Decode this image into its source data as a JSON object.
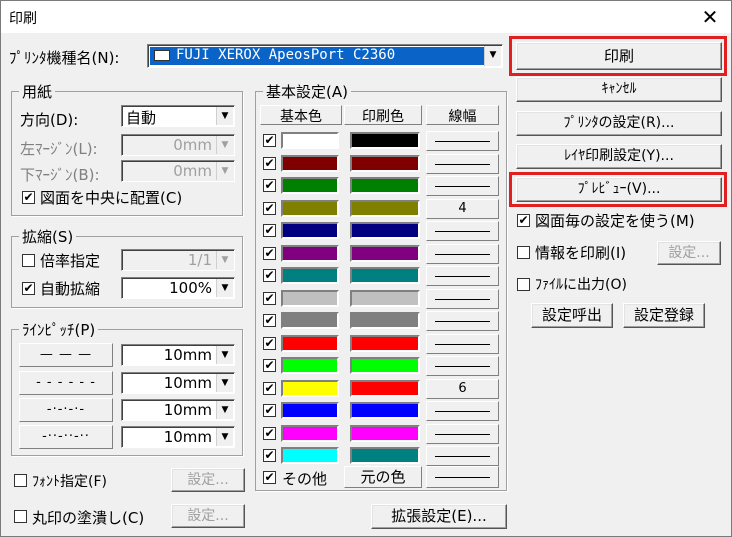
{
  "window": {
    "title": "印刷",
    "close": "✕"
  },
  "printer": {
    "label": "ﾌﾟﾘﾝﾀ機種名(N):",
    "selected": "FUJI XEROX ApeosPort C2360"
  },
  "paper": {
    "group_label": "用紙",
    "direction_label": "方向(D):",
    "direction_value": "自動",
    "left_margin_label": "左ﾏｰｼﾞﾝ(L):",
    "left_margin_value": "0mm",
    "bottom_margin_label": "下ﾏｰｼﾞﾝ(B):",
    "bottom_margin_value": "0mm",
    "center_label": "図面を中央に配置(C)",
    "center_checked": true
  },
  "scale": {
    "group_label": "拡縮(S)",
    "ratio_label": "倍率指定",
    "ratio_checked": false,
    "ratio_value": "1/1",
    "auto_label": "自動拡縮",
    "auto_checked": true,
    "auto_value": "100%"
  },
  "linepitch": {
    "group_label": "ﾗｲﾝﾋﾟｯﾁ(P)",
    "rows": [
      {
        "pattern": "— — —",
        "value": "10mm"
      },
      {
        "pattern": "- - - - - -",
        "value": "10mm"
      },
      {
        "pattern": "-·-·-·-",
        "value": "10mm"
      },
      {
        "pattern": "-··-··-··",
        "value": "10mm"
      }
    ]
  },
  "font_spec": {
    "label": "ﾌｫﾝﾄ指定(F)",
    "checked": false,
    "button": "設定..."
  },
  "circle_fill": {
    "label": "丸印の塗潰し(C)",
    "checked": false,
    "button": "設定..."
  },
  "basic": {
    "group_label": "基本設定(A)",
    "col_base": "基本色",
    "col_print": "印刷色",
    "col_width": "線幅",
    "rows": [
      {
        "checked": true,
        "base": "#ffffff",
        "print": "#000000",
        "width": ""
      },
      {
        "checked": true,
        "base": "#800000",
        "print": "#800000",
        "width": ""
      },
      {
        "checked": true,
        "base": "#008000",
        "print": "#008000",
        "width": ""
      },
      {
        "checked": true,
        "base": "#808000",
        "print": "#808000",
        "width": "4"
      },
      {
        "checked": true,
        "base": "#000080",
        "print": "#000080",
        "width": ""
      },
      {
        "checked": true,
        "base": "#800080",
        "print": "#800080",
        "width": ""
      },
      {
        "checked": true,
        "base": "#008080",
        "print": "#008080",
        "width": ""
      },
      {
        "checked": true,
        "base": "#c0c0c0",
        "print": "#c0c0c0",
        "width": ""
      },
      {
        "checked": true,
        "base": "#808080",
        "print": "#808080",
        "width": ""
      },
      {
        "checked": true,
        "base": "#ff0000",
        "print": "#ff0000",
        "width": ""
      },
      {
        "checked": true,
        "base": "#00ff00",
        "print": "#00ff00",
        "width": ""
      },
      {
        "checked": true,
        "base": "#ffff00",
        "print": "#ff0000",
        "width": "6"
      },
      {
        "checked": true,
        "base": "#0000ff",
        "print": "#0000ff",
        "width": ""
      },
      {
        "checked": true,
        "base": "#ff00ff",
        "print": "#ff00ff",
        "width": ""
      },
      {
        "checked": true,
        "base": "#00ffff",
        "print": "#008080",
        "width": ""
      }
    ],
    "other_label": "その他",
    "other_checked": true,
    "original_color": "元の色"
  },
  "buttons": {
    "print": "印刷",
    "cancel": "ｷｬﾝｾﾙ",
    "printer_settings": "ﾌﾟﾘﾝﾀの設定(R)...",
    "layer_settings": "ﾚｲﾔ印刷設定(Y)...",
    "preview": "ﾌﾟﾚﾋﾞｭｰ(V)...",
    "settings_disabled": "設定...",
    "call_settings": "設定呼出",
    "register_settings": "設定登録",
    "extended": "拡張設定(E)..."
  },
  "options": {
    "per_drawing_label": "図面毎の設定を使う(M)",
    "per_drawing_checked": true,
    "print_info_label": "情報を印刷(I)",
    "print_info_checked": false,
    "file_output_label": "ﾌｧｲﾙに出力(O)",
    "file_output_checked": false
  }
}
